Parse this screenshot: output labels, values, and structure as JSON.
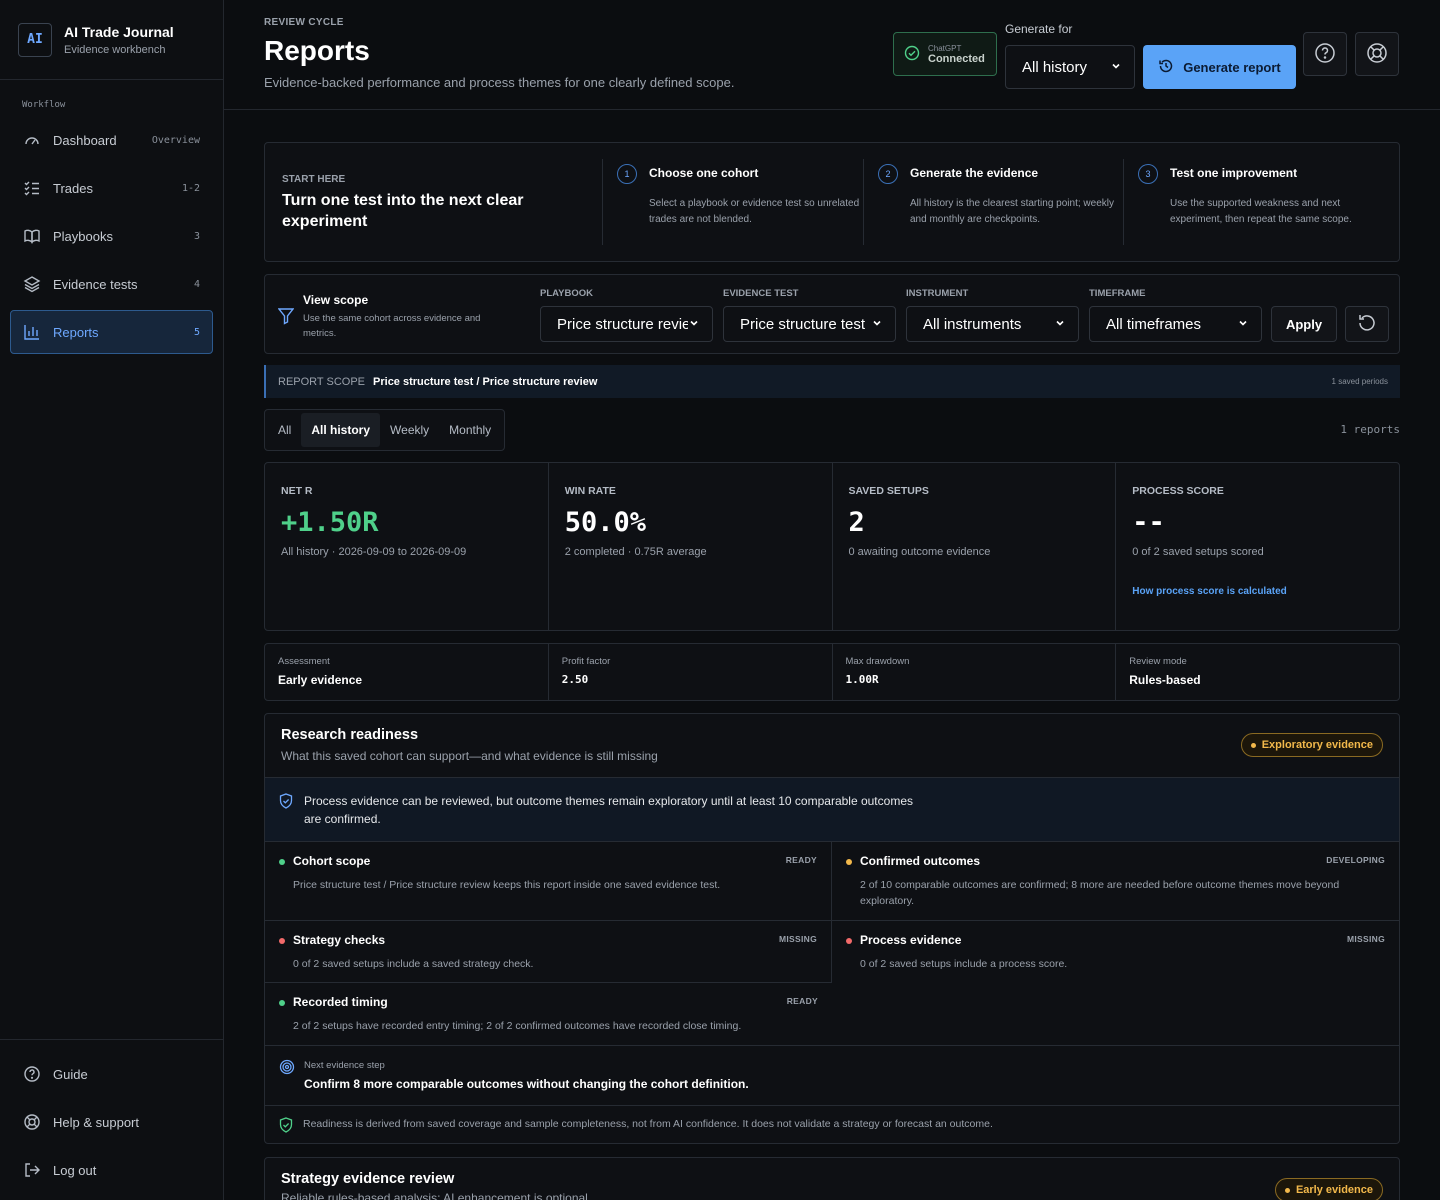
{
  "brand": {
    "logo": "AI",
    "title": "AI Trade Journal",
    "subtitle": "Evidence workbench"
  },
  "sidebar": {
    "section": "Workflow",
    "items": [
      {
        "label": "Dashboard",
        "count": "Overview",
        "icon": "gauge-icon"
      },
      {
        "label": "Trades",
        "count": "1-2",
        "icon": "checklist-icon"
      },
      {
        "label": "Playbooks",
        "count": "3",
        "icon": "book-icon"
      },
      {
        "label": "Evidence tests",
        "count": "4",
        "icon": "layers-icon"
      },
      {
        "label": "Reports",
        "count": "5",
        "icon": "bar-chart-icon",
        "active": true
      }
    ],
    "bottom": [
      {
        "label": "Guide",
        "icon": "help-circle-icon"
      },
      {
        "label": "Help & support",
        "icon": "lifebuoy-icon"
      },
      {
        "label": "Log out",
        "icon": "logout-icon"
      }
    ]
  },
  "header": {
    "eyebrow": "REVIEW CYCLE",
    "title": "Reports",
    "description": "Evidence-backed performance and process themes for one clearly defined scope.",
    "connection": {
      "sub": "ChatGPT",
      "status": "Connected"
    },
    "generate_for_label": "Generate for",
    "generate_for_value": "All history",
    "generate_button": "Generate report"
  },
  "start": {
    "eyebrow": "START HERE",
    "title": "Turn one test into the next clear experiment",
    "steps": [
      {
        "num": "1",
        "title": "Choose one cohort",
        "desc": "Select a playbook or evidence test so unrelated trades are not blended."
      },
      {
        "num": "2",
        "title": "Generate the evidence",
        "desc": "All history is the clearest starting point; weekly and monthly are checkpoints."
      },
      {
        "num": "3",
        "title": "Test one improvement",
        "desc": "Use the supported weakness and next experiment, then repeat the same scope."
      }
    ]
  },
  "scope": {
    "title": "View scope",
    "desc": "Use the same cohort across evidence and metrics.",
    "filters": [
      {
        "label": "PLAYBOOK",
        "value": "Price structure review"
      },
      {
        "label": "EVIDENCE TEST",
        "value": "Price structure test"
      },
      {
        "label": "INSTRUMENT",
        "value": "All instruments"
      },
      {
        "label": "TIMEFRAME",
        "value": "All timeframes"
      }
    ],
    "apply": "Apply"
  },
  "report_scope": {
    "key": "REPORT SCOPE",
    "value": "Price structure test / Price structure review",
    "saved": "1 saved periods"
  },
  "tabs": [
    "All",
    "All history",
    "Weekly",
    "Monthly"
  ],
  "active_tab": "All history",
  "reports_count": "1 reports",
  "metrics": [
    {
      "label": "NET R",
      "value": "+1.50R",
      "sub": "All history · 2026-09-09 to 2026-09-09",
      "color": "#4fd08a"
    },
    {
      "label": "WIN RATE",
      "value": "50.0%",
      "sub": "2 completed · 0.75R average"
    },
    {
      "label": "SAVED SETUPS",
      "value": "2",
      "sub": "0 awaiting outcome evidence"
    },
    {
      "label": "PROCESS SCORE",
      "value": "--",
      "sub": "0 of 2 saved setups scored",
      "link": "How process score is calculated"
    }
  ],
  "secondary": [
    {
      "label": "Assessment",
      "value": "Early evidence"
    },
    {
      "label": "Profit factor",
      "value": "2.50"
    },
    {
      "label": "Max drawdown",
      "value": "1.00R"
    },
    {
      "label": "Review mode",
      "value": "Rules-based"
    }
  ],
  "readiness": {
    "title": "Research readiness",
    "subtitle": "What this saved cohort can support—and what evidence is still missing",
    "badge": "Exploratory evidence",
    "note": "Process evidence can be reviewed, but outcome themes remain exploratory until at least 10 comparable outcomes are confirmed.",
    "checks": [
      {
        "title": "Cohort scope",
        "status": "READY",
        "desc": "Price structure test / Price structure review keeps this report inside one saved evidence test.",
        "color": "#4fd08a"
      },
      {
        "title": "Confirmed outcomes",
        "status": "DEVELOPING",
        "desc": "2 of 10 comparable outcomes are confirmed; 8 more are needed before outcome themes move beyond exploratory.",
        "color": "#f2b84b"
      },
      {
        "title": "Strategy checks",
        "status": "MISSING",
        "desc": "0 of 2 saved setups include a saved strategy check.",
        "color": "#f26a6a"
      },
      {
        "title": "Process evidence",
        "status": "MISSING",
        "desc": "0 of 2 saved setups include a process score.",
        "color": "#f26a6a"
      },
      {
        "title": "Recorded timing",
        "status": "READY",
        "desc": "2 of 2 setups have recorded entry timing; 2 of 2 confirmed outcomes have recorded close timing.",
        "color": "#4fd08a"
      }
    ],
    "next_label": "Next evidence step",
    "next_text": "Confirm 8 more comparable outcomes without changing the cohort definition.",
    "disclaimer": "Readiness is derived from saved coverage and sample completeness, not from AI confidence. It does not validate a strategy or forecast an outcome."
  },
  "strategy": {
    "title": "Strategy evidence review",
    "subtitle": "Reliable rules-based analysis; AI enhancement is optional",
    "badge": "Early evidence"
  }
}
